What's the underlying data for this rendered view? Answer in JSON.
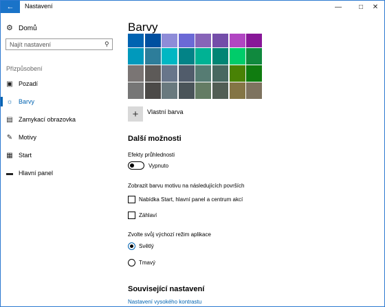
{
  "window": {
    "title": "Nastavení",
    "back_icon": "back-arrow-icon",
    "controls": [
      "minimize-icon",
      "maximize-icon",
      "close-icon"
    ],
    "accent_color": "#0063b1"
  },
  "sidebar": {
    "home_label": "Domů",
    "search_placeholder": "Najít nastavení",
    "group_label": "Přizpůsobení",
    "items": [
      {
        "label": "Pozadí",
        "icon": "picture-icon",
        "active": false
      },
      {
        "label": "Barvy",
        "icon": "palette-icon",
        "active": true
      },
      {
        "label": "Zamykací obrazovka",
        "icon": "lock-screen-icon",
        "active": false
      },
      {
        "label": "Motivy",
        "icon": "themes-icon",
        "active": false
      },
      {
        "label": "Start",
        "icon": "start-icon",
        "active": false
      },
      {
        "label": "Hlavní panel",
        "icon": "taskbar-icon",
        "active": false
      }
    ]
  },
  "main": {
    "title": "Barvy",
    "swatch_rows": [
      [
        "#0063b1",
        "#0050a0",
        "#8e8cd8",
        "#6b69d6",
        "#8764b8",
        "#744da9",
        "#b146c2",
        "#881798"
      ],
      [
        "#0099bc",
        "#2d7d9a",
        "#00b7c3",
        "#038387",
        "#00b294",
        "#018574",
        "#00cc6a",
        "#10893e"
      ],
      [
        "#7a7574",
        "#5d5a58",
        "#68768a",
        "#515c6b",
        "#567c73",
        "#486860",
        "#498205",
        "#107c10"
      ],
      [
        "#767676",
        "#4c4a48",
        "#69797e",
        "#4a5459",
        "#647c64",
        "#525e54",
        "#847545",
        "#7e735f"
      ]
    ],
    "custom_color_label": "Vlastní barva",
    "more_options_heading": "Další možnosti",
    "transparency_label": "Efekty průhlednosti",
    "transparency_state": "Vypnuto",
    "surfaces_label": "Zobrazit barvu motivu na následujících površích",
    "surface_start": "Nabídka Start, hlavní panel a centrum akcí",
    "surface_titlebars": "Záhlaví",
    "app_mode_label": "Zvolte svůj výchozí režim aplikace",
    "mode_light": "Světlý",
    "mode_dark": "Tmavý",
    "related_heading": "Související nastavení",
    "related_link": "Nastavení vysokého kontrastu"
  }
}
